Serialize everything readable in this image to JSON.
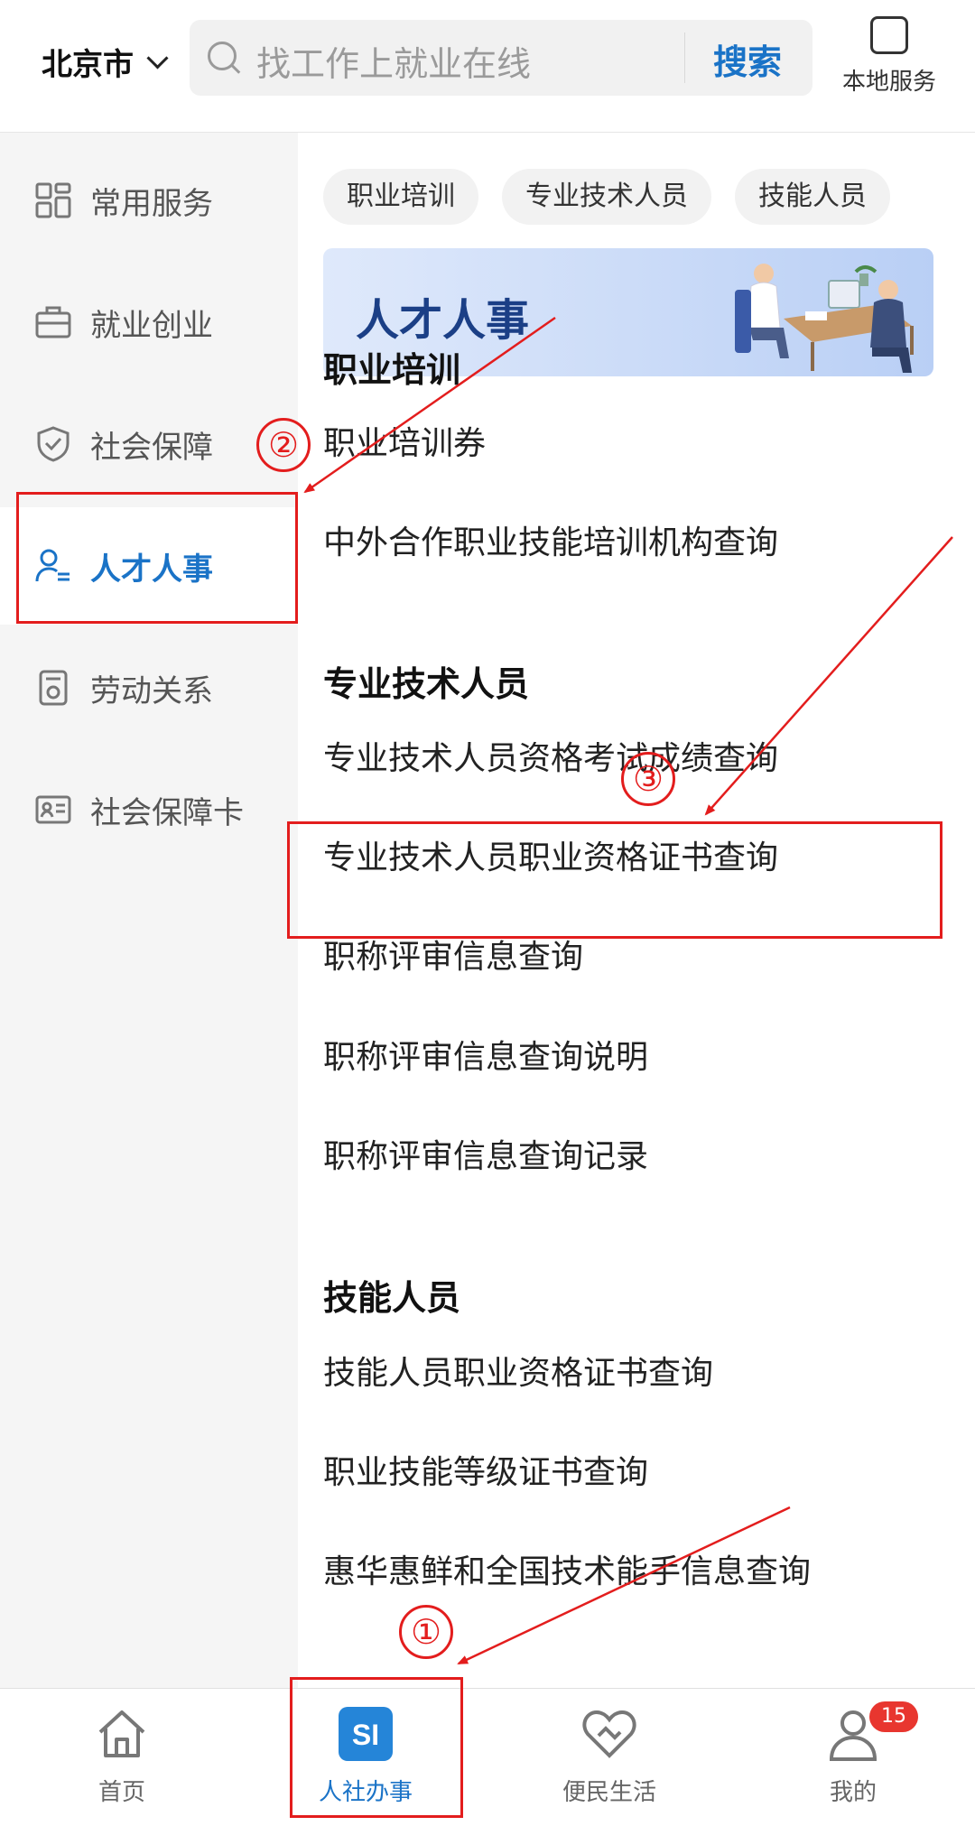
{
  "header": {
    "city": "北京市",
    "search_placeholder": "找工作上就业在线",
    "search_button": "搜索",
    "local_service": "本地服务"
  },
  "sidebar": {
    "items": [
      {
        "label": "常用服务",
        "icon": "grid-icon"
      },
      {
        "label": "就业创业",
        "icon": "briefcase-icon"
      },
      {
        "label": "社会保障",
        "icon": "shield-icon"
      },
      {
        "label": "人才人事",
        "icon": "person-list-icon",
        "active": true
      },
      {
        "label": "劳动关系",
        "icon": "document-icon"
      },
      {
        "label": "社会保障卡",
        "icon": "id-card-icon"
      }
    ]
  },
  "main": {
    "chips": [
      "职业培训",
      "专业技术人员",
      "技能人员"
    ],
    "banner_title": "人才人事",
    "sections": [
      {
        "title": "职业培训",
        "items": [
          "职业培训券",
          "中外合作职业技能培训机构查询"
        ]
      },
      {
        "title": "专业技术人员",
        "items": [
          "专业技术人员资格考试成绩查询",
          "专业技术人员职业资格证书查询",
          "职称评审信息查询",
          "职称评审信息查询说明",
          "职称评审信息查询记录"
        ]
      },
      {
        "title": "技能人员",
        "items": [
          "技能人员职业资格证书查询",
          "职业技能等级证书查询",
          "惠华惠鲜和全国技术能手信息查询"
        ]
      }
    ]
  },
  "tabbar": {
    "tabs": [
      {
        "label": "首页",
        "icon": "home-icon"
      },
      {
        "label": "人社办事",
        "icon": "si-logo-icon",
        "active": true
      },
      {
        "label": "便民生活",
        "icon": "heart-hand-icon"
      },
      {
        "label": "我的",
        "icon": "user-icon",
        "badge": "15"
      }
    ]
  },
  "annotations": {
    "step1": "①",
    "step2": "②",
    "step3": "③",
    "color": "#e31d1d"
  },
  "colors": {
    "accent": "#1a73c7",
    "badge": "#e8362f"
  }
}
